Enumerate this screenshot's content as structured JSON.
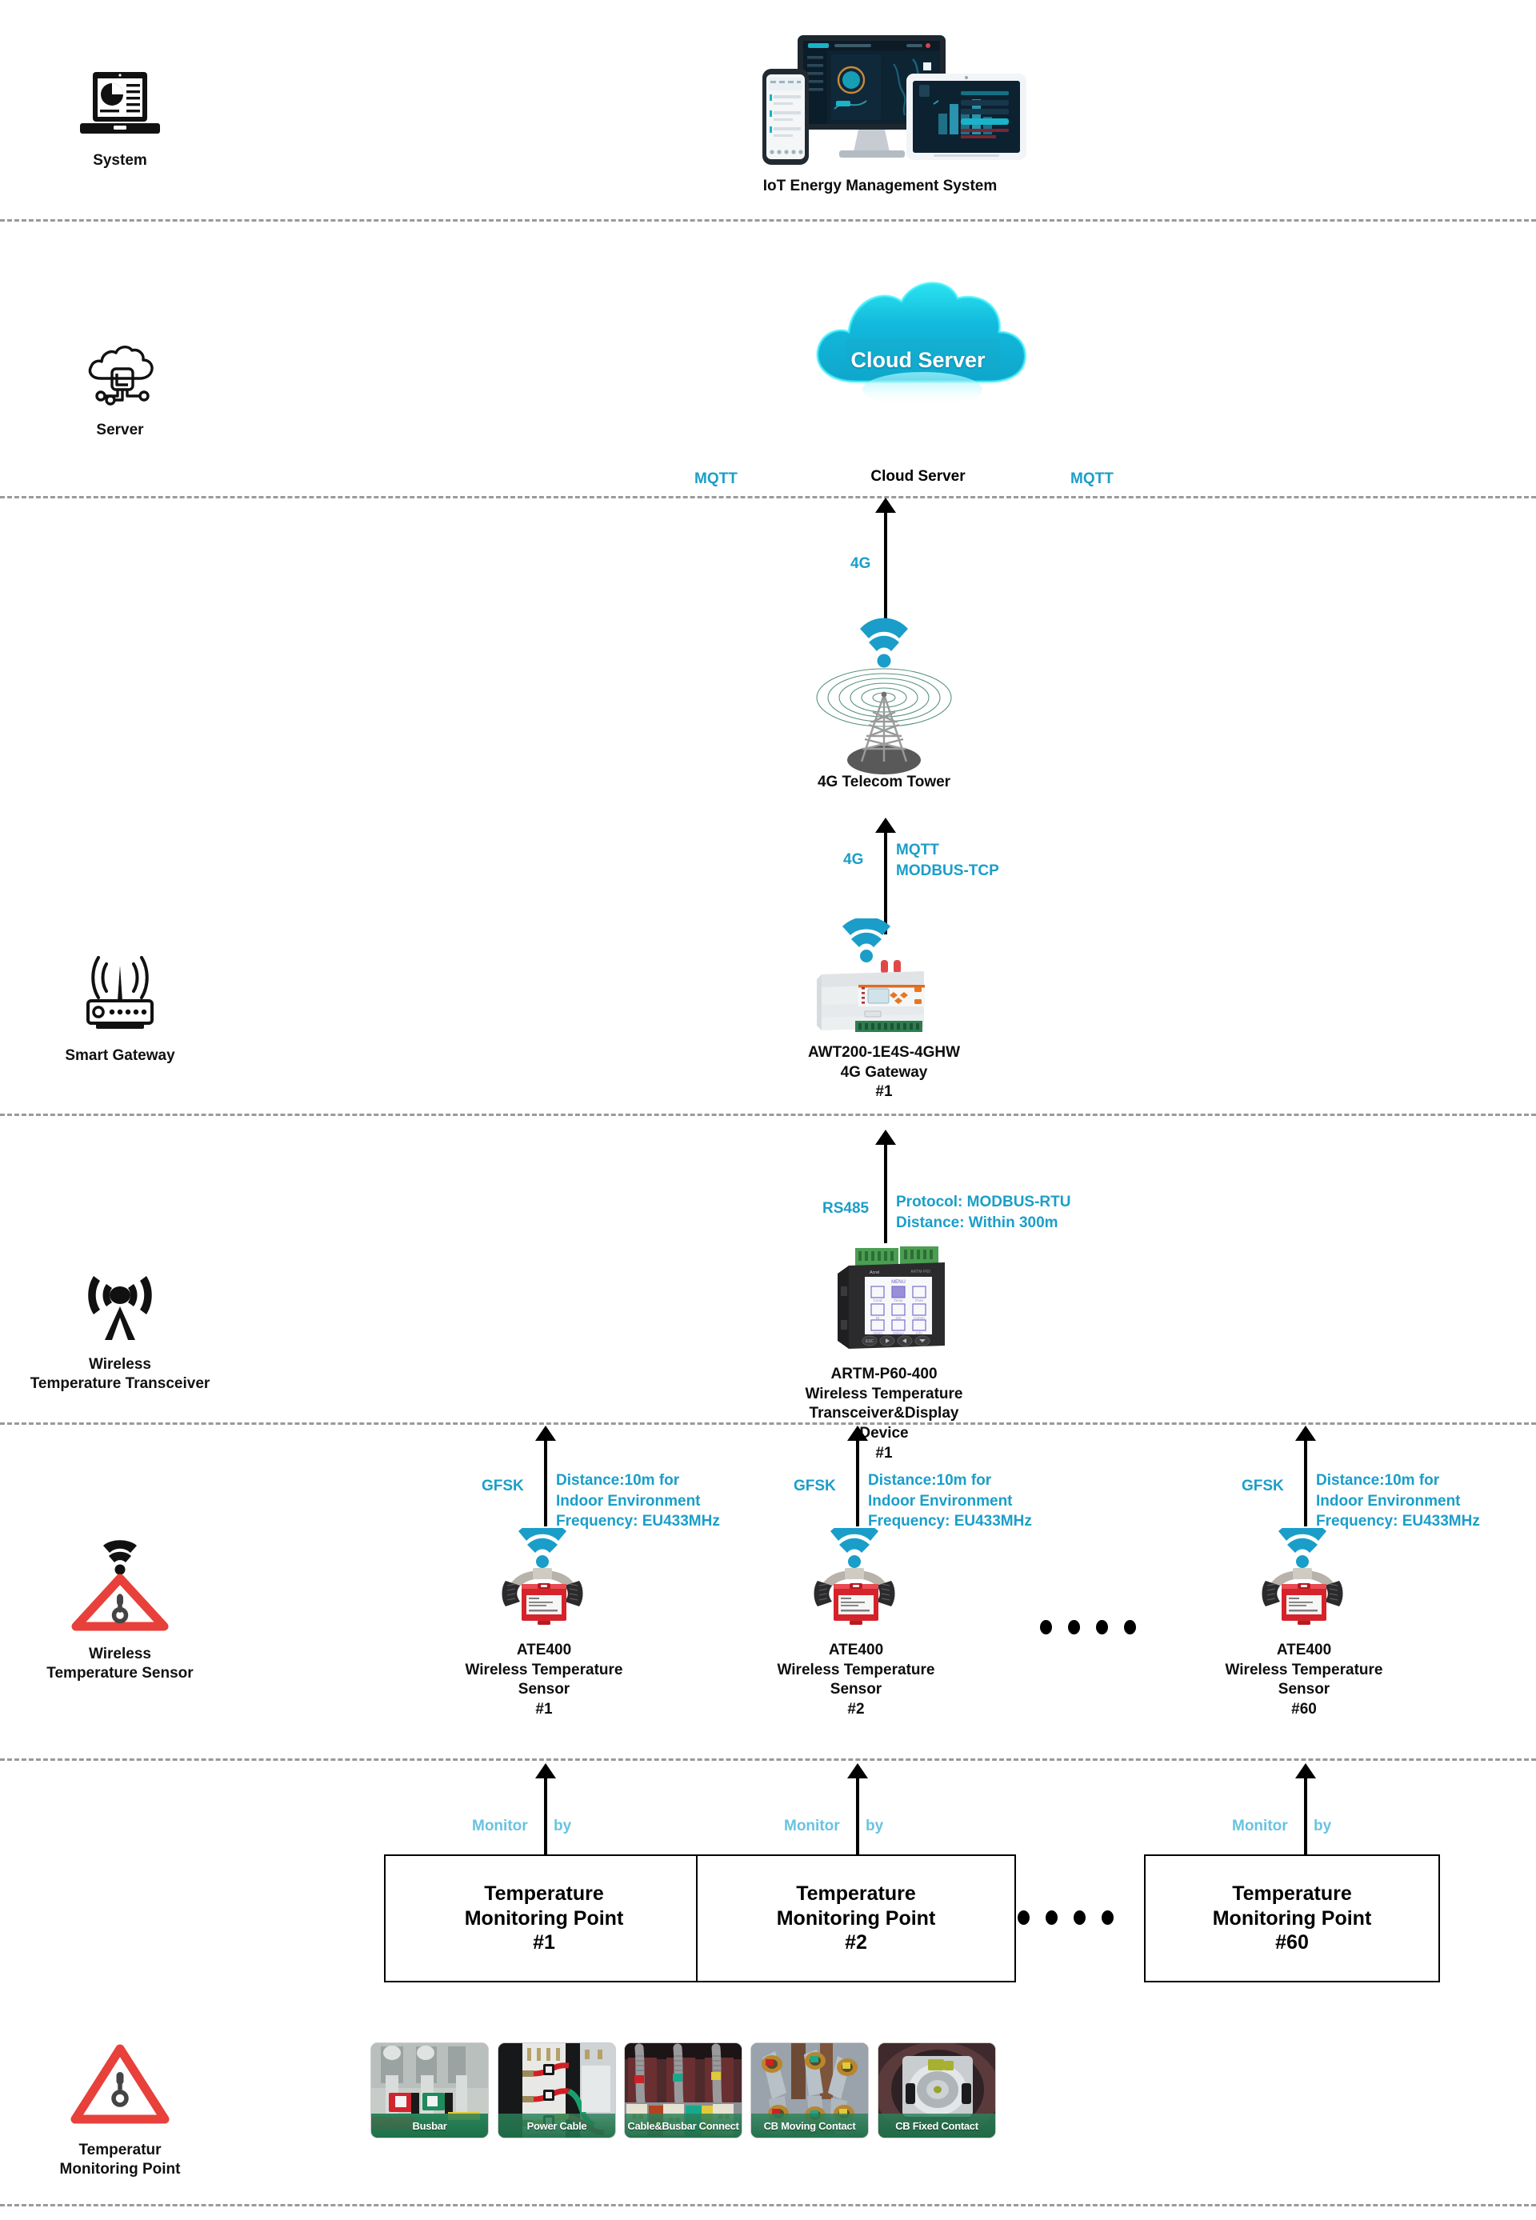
{
  "rail": [
    {
      "label": "System",
      "icon": "laptop-chart-icon"
    },
    {
      "label": "Server",
      "icon": "cloud-server-icon"
    },
    {
      "label": "Smart Gateway",
      "icon": "router-icon"
    },
    {
      "label": "Wireless\nTemperature Transceiver",
      "icon": "antenna-tower-icon"
    },
    {
      "label": "Wireless\nTemperature Sensor",
      "icon": "wifi-warning-thermometer-icon"
    },
    {
      "label": "Temperatur\nMonitoring Point",
      "icon": "warning-thermometer-icon"
    }
  ],
  "nodes": {
    "iot_system": {
      "caption": "IoT Energy Management System"
    },
    "cloud": {
      "badge": "Cloud Server",
      "caption": "Cloud Server"
    },
    "tower": {
      "caption": "4G Telecom Tower"
    },
    "gateway": {
      "caption": "AWT200-1E4S-4GHW\n4G Gateway\n#1"
    },
    "transceiver": {
      "caption": "ARTM-P60-400\nWireless Temperature Transceiver&Display Device\n#1"
    },
    "sensors": [
      {
        "caption": "ATE400\nWireless Temperature Sensor\n#1"
      },
      {
        "caption": "ATE400\nWireless Temperature Sensor\n#2"
      },
      {
        "caption": "ATE400\nWireless Temperature Sensor\n#60"
      }
    ],
    "monitoring_points": [
      {
        "label": "Temperature\nMonitoring Point\n#1"
      },
      {
        "label": "Temperature\nMonitoring Point\n#2"
      },
      {
        "label": "Temperature\nMonitoring Point\n#60"
      }
    ]
  },
  "protocols": {
    "mqtt_left": "MQTT",
    "mqtt_right": "MQTT",
    "tower_to_cloud": "4G",
    "gateway_link_left": "4G",
    "gateway_link_right": "MQTT\nMODBUS-TCP",
    "transceiver_link_left": "RS485",
    "transceiver_link_right": "Protocol: MODBUS-RTU\nDistance: Within 300m",
    "sensor_link_left": "GFSK",
    "sensor_link_right": "Distance:10m for\nIndoor Environment\nFrequency: EU433MHz",
    "monitor_by_a": "Monitor",
    "monitor_by_b": "by"
  },
  "photos": [
    {
      "caption": "Busbar"
    },
    {
      "caption": "Power Cable"
    },
    {
      "caption": "Cable&Busbar Connect"
    },
    {
      "caption": "CB Moving Contact"
    },
    {
      "caption": "CB Fixed Contact"
    }
  ],
  "colors": {
    "accent": "#1a9ec9",
    "accent_light": "#69c3e0",
    "cloud": "#17b6d6",
    "warning_red": "#e8403a",
    "separator": "#9a9a9a",
    "caption_green": "#2c825a"
  }
}
